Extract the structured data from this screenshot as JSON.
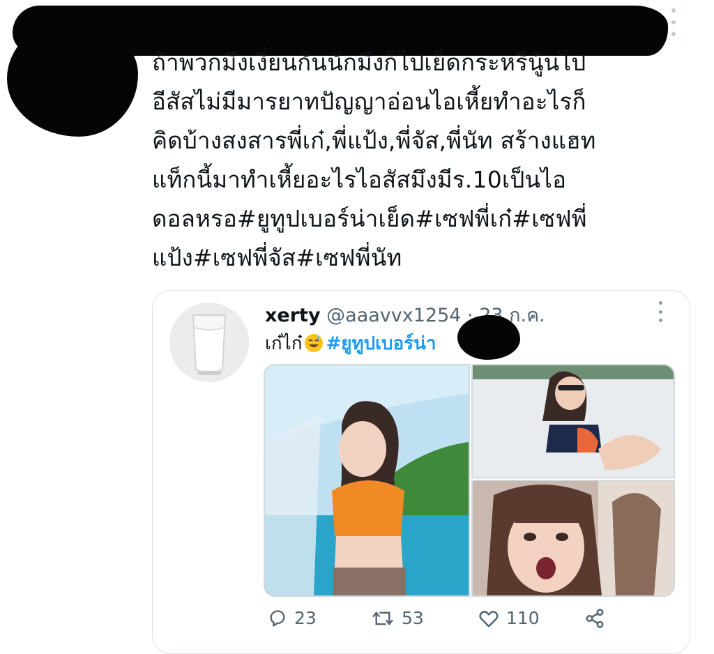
{
  "tweet": {
    "text": "ถ้าพวกมึงเงี่ยนกันนักมึงก็ไปเย็ดกระหรี่นู้นไป\nอีสัสไม่มีมารยาทปัญญาอ่อนไอเหี้ยทำอะไรก็\nคิดบ้างสงสารพี่เก๋,พี่แป้ง,พี่จัส,พี่นัท สร้างแฮท\nแท็กนี้มาทำเหี้ยอะไรไอสัสมึงมีร.10เป็นไอ\nดอลหรอ#ยูทูปเบอร์น่าเย็ด#เซฟพี่เก๋#เซฟพี่\nแป้ง#เซฟพี่จัส#เซฟพี่นัท"
  },
  "quoted": {
    "name": "xerty",
    "handle": "@aaavvx1254",
    "separator": "·",
    "date": "23 ก.ค.",
    "text_prefix": "เก๋ไก๋",
    "emoji": "grinning-sweat-emoji",
    "hashtag": "#ยูทูปเบอร์น่า",
    "replies": "23",
    "retweets": "53",
    "likes": "110"
  },
  "icons": {
    "reply": "reply-icon",
    "retweet": "retweet-icon",
    "like": "heart-icon",
    "share": "share-icon",
    "more": "more-vertical-icon"
  },
  "colors": {
    "text": "#0f1419",
    "muted": "#536471",
    "link": "#1d9bf0",
    "border": "#dde2e6",
    "redaction": "#050505"
  }
}
